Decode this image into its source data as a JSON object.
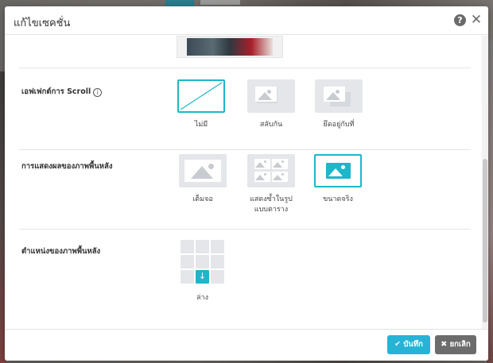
{
  "dialog": {
    "title": "แก้ไขเซคชั่น",
    "help_glyph": "?",
    "close_glyph": "✕"
  },
  "scroll_effect": {
    "label": "เอฟเฟกต์การ Scroll",
    "info_glyph": "i",
    "options": [
      {
        "label": "ไม่มี",
        "selected": true,
        "icon": "none-slash-icon"
      },
      {
        "label": "สลับกัน",
        "selected": false,
        "icon": "parallax-image-icon"
      },
      {
        "label": "ยึดอยู่กับที่",
        "selected": false,
        "icon": "fixed-image-icon"
      }
    ]
  },
  "background_display": {
    "label": "การแสดงผลของภาพพื้นหลัง",
    "options": [
      {
        "label": "เต็มจอ",
        "selected": false,
        "icon": "fullscreen-image-icon"
      },
      {
        "label": "แสดงซ้ำในรูปแบบตาราง",
        "label_line1": "แสดงซ้ำในรูป",
        "label_line2": "แบบตาราง",
        "selected": false,
        "icon": "tile-image-icon"
      },
      {
        "label": "ขนาดจริง",
        "selected": true,
        "icon": "actual-size-image-icon"
      }
    ]
  },
  "background_position": {
    "label": "ตำแหน่งของภาพพื้นหลัง",
    "selected_label": "ล่าง",
    "active_glyph": "↓"
  },
  "footer": {
    "save_label": "บันทึก",
    "save_glyph": "✔",
    "cancel_label": "ยกเลิก",
    "cancel_glyph": "✖"
  },
  "colors": {
    "accent": "#1eb6c9",
    "save_button": "#27b3d6",
    "cancel_button": "#6c6c6c"
  }
}
